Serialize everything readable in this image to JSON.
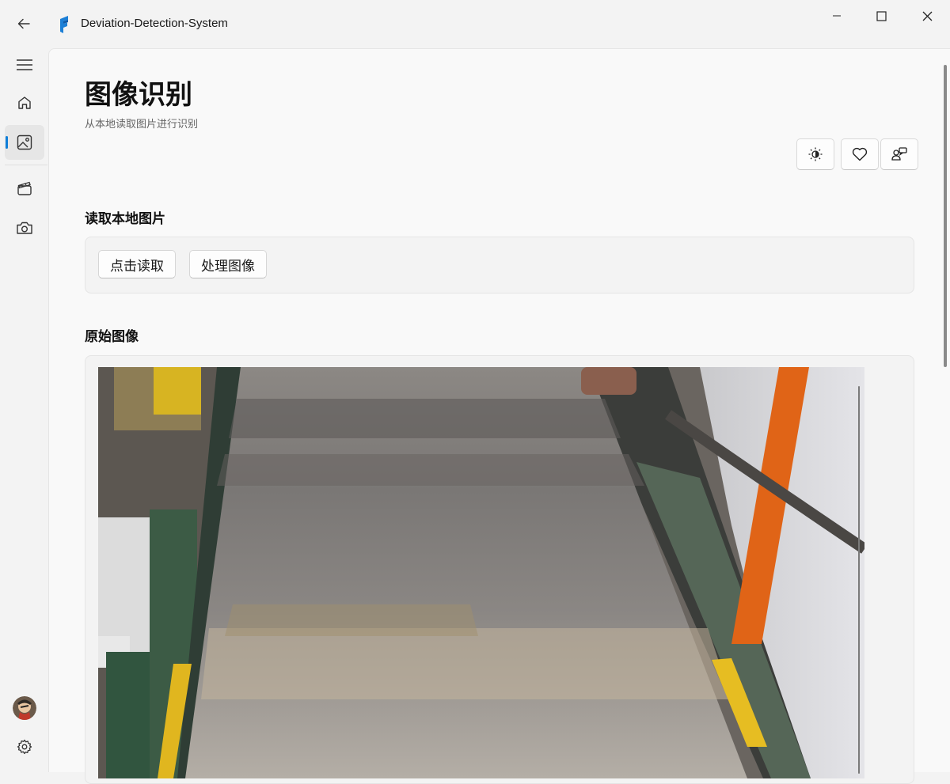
{
  "window": {
    "title": "Deviation-Detection-System",
    "accent": "#0f7ed8"
  },
  "nav": {
    "items": [
      {
        "name": "menu",
        "icon": "hamburger-icon"
      },
      {
        "name": "home",
        "icon": "home-icon"
      },
      {
        "name": "image-recognition",
        "icon": "image-icon",
        "selected": true
      },
      {
        "name": "video",
        "icon": "clapperboard-icon"
      },
      {
        "name": "camera",
        "icon": "camera-icon"
      }
    ],
    "footer": [
      {
        "name": "account",
        "icon": "avatar"
      },
      {
        "name": "settings",
        "icon": "gear-icon"
      }
    ]
  },
  "page": {
    "title": "图像识别",
    "subtitle": "从本地读取图片进行识别"
  },
  "toolbar": {
    "buttons": [
      {
        "icon": "theme-toggle-icon"
      },
      {
        "icon": "heart-icon"
      },
      {
        "icon": "feedback-icon"
      }
    ]
  },
  "read_section": {
    "title": "读取本地图片",
    "read_button": "点击读取",
    "process_button": "处理图像"
  },
  "original_section": {
    "title": "原始图像",
    "image_description_icon": "conveyor-belt-photo"
  }
}
